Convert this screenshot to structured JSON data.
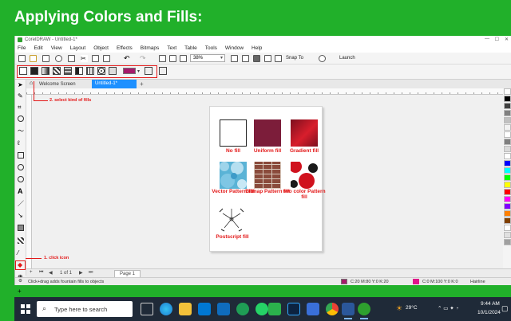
{
  "slide": {
    "title": "Applying Colors and Fills:"
  },
  "app": {
    "window_title": "CorelDRAW - Untitled-1*",
    "menu": [
      "File",
      "Edit",
      "View",
      "Layout",
      "Object",
      "Effects",
      "Bitmaps",
      "Text",
      "Table",
      "Tools",
      "Window",
      "Help"
    ],
    "zoom": "38%",
    "snap_to": "Snap To",
    "launch": "Launch",
    "tabs": {
      "welcome": "Welcome Screen",
      "document": "Untitled-1*"
    },
    "pager": {
      "label": "1 of 1",
      "page_tab": "Page 1"
    },
    "status": {
      "hint": "Click+drag adds fountain fills to objects",
      "fill_cmyk": "C:20 M:80 Y:0 K:20",
      "outline_cmyk": "C:0 M:100 Y:0 K:0",
      "outline_width": "Hairline"
    },
    "colors": {
      "accent": "#a51b6a",
      "outline": "#e0158a",
      "tab_active": "#1e90ff",
      "annotation": "#e31818"
    }
  },
  "annotations": {
    "select_fills": "2. select kind of fills",
    "click_icon": "1. click icon"
  },
  "fills": [
    {
      "label": "No fill",
      "icon": "no-fill"
    },
    {
      "label": "Uniform fill",
      "color": "#7c1d3a"
    },
    {
      "label": "Gradient fill",
      "color": "#c11b2b"
    },
    {
      "label": "Vector Pattern fill",
      "icon": "vector-pattern"
    },
    {
      "label": "Bitmap Pattern fill",
      "icon": "brick-bitmap"
    },
    {
      "label": "two color Pattern fill",
      "icon": "two-color-pattern"
    },
    {
      "label": "Postscript fill",
      "icon": "postscript-pattern"
    }
  ],
  "palette": [
    "#ffffff",
    "#000000",
    "#404040",
    "#808080",
    "#c0c0c0",
    "#f2f2f2",
    "#ffffff",
    "#7f7f7f",
    "#d9d9d9",
    "#ffffff",
    "#0000ff",
    "#00ffff",
    "#00ff00",
    "#ffff00",
    "#ff0000",
    "#ff00ff",
    "#8000ff",
    "#ff8000",
    "#804000",
    "#ffffff",
    "#e0e0e0",
    "#a0a0a0"
  ],
  "taskbar": {
    "search_placeholder": "Type here to search",
    "weather": "29°C",
    "time": "9:44 AM",
    "date": "10/1/2024"
  }
}
